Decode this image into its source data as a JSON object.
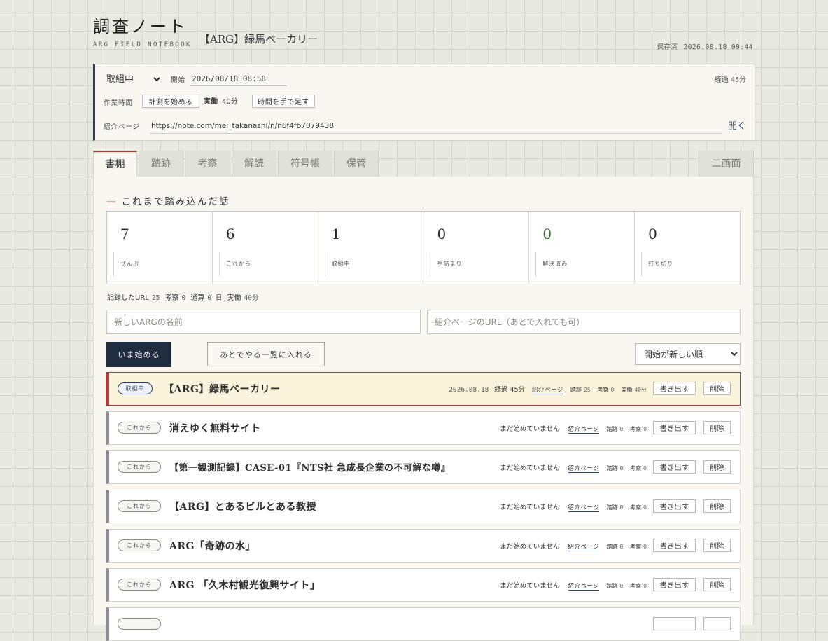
{
  "header": {
    "app_title": "調査ノート",
    "app_subtitle": "ARG FIELD NOTEBOOK",
    "current_title": "【ARG】緑馬ベーカリー",
    "saved_label": "保存済",
    "saved_time": "2026.08.18 09:44"
  },
  "status_panel": {
    "status_value": "取組中",
    "start_label": "開始",
    "start_value": "2026/08/18 08:58",
    "elapsed_label": "経過",
    "elapsed_value": "45分",
    "worktime_label": "作業時間",
    "measure_button": "計測を始める",
    "actual_label": "実働",
    "actual_value": "40分",
    "add_time_button": "時間を手で足す",
    "intro_label": "紹介ページ",
    "intro_url": "https://note.com/mei_takanashi/n/n6f4fb7079438",
    "open_label": "開く"
  },
  "tabs": [
    {
      "label": "書棚",
      "active": true
    },
    {
      "label": "踏跡",
      "active": false
    },
    {
      "label": "考察",
      "active": false
    },
    {
      "label": "解読",
      "active": false
    },
    {
      "label": "符号帳",
      "active": false
    },
    {
      "label": "保管",
      "active": false
    }
  ],
  "split_view_label": "二画面",
  "section_title": "これまで踏み込んだ話",
  "stats": [
    {
      "value": "7",
      "label": "ぜんぶ"
    },
    {
      "value": "6",
      "label": "これから"
    },
    {
      "value": "1",
      "label": "取組中"
    },
    {
      "value": "0",
      "label": "手詰まり"
    },
    {
      "value": "0",
      "label": "解決済み"
    },
    {
      "value": "0",
      "label": "打ち切り"
    }
  ],
  "summary": {
    "urls_label": "記録したURL",
    "urls_value": "25",
    "thoughts_label": "考察",
    "thoughts_value": "0",
    "total_label": "通算",
    "total_value": "0 日",
    "actual_label": "実働",
    "actual_value": "40分"
  },
  "new_form": {
    "name_placeholder": "新しいARGの名前",
    "url_placeholder": "紹介ページのURL（あとで入れても可）",
    "start_button": "いま始める",
    "later_button": "あとでやる一覧に入れる",
    "sort_value": "開始が新しい順"
  },
  "row_labels": {
    "intro_link": "紹介ページ",
    "trail_label": "踏跡",
    "thought_label": "考察",
    "actual_label": "実働",
    "elapsed_label": "経過",
    "export_button": "書き出す",
    "delete_button": "削除"
  },
  "rows": [
    {
      "badge": "取組中",
      "title": "【ARG】緑馬ベーカリー",
      "date": "2026.08.18",
      "elapsed": "45分",
      "trail": "25",
      "thought": "0",
      "actual": "40分"
    },
    {
      "badge": "これから",
      "title": "消えゆく無料サイト",
      "not_started": "まだ始めていません",
      "trail": "0",
      "thought": "0"
    },
    {
      "badge": "これから",
      "title": "【第一観測記録】CASE-01『NTS社 急成長企業の不可解な噂』",
      "not_started": "まだ始めていません",
      "trail": "0",
      "thought": "0"
    },
    {
      "badge": "これから",
      "title": "【ARG】とあるビルとある教授",
      "not_started": "まだ始めていません",
      "trail": "0",
      "thought": "0"
    },
    {
      "badge": "これから",
      "title": "ARG「奇跡の水」",
      "not_started": "まだ始めていません",
      "trail": "0",
      "thought": "0"
    },
    {
      "badge": "これから",
      "title": "ARG 「久木村観光復興サイト」",
      "not_started": "まだ始めていません",
      "trail": "0",
      "thought": "0"
    }
  ]
}
